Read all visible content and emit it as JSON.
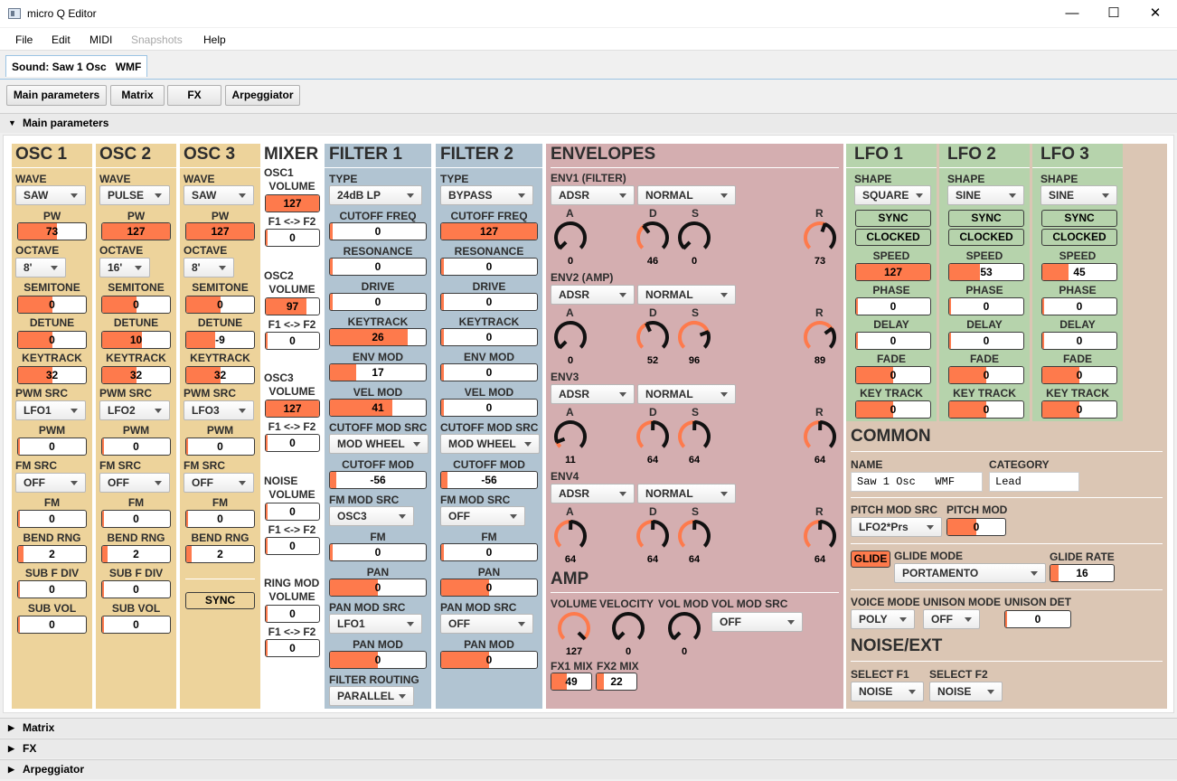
{
  "window": {
    "title": "micro Q Editor"
  },
  "menu": [
    "File",
    "Edit",
    "MIDI",
    "Snapshots",
    "Help"
  ],
  "tab": "Sound: Saw 1 Osc   WMF",
  "sections": [
    "Main parameters",
    "Matrix",
    "FX",
    "Arpeggiator"
  ],
  "lbl": {
    "wave": "WAVE",
    "pw": "PW",
    "octave": "OCTAVE",
    "semitone": "SEMITONE",
    "detune": "DETUNE",
    "keytrack": "KEYTRACK",
    "pwmsrc": "PWM SRC",
    "pwm": "PWM",
    "fmsrc": "FM SRC",
    "fm": "FM",
    "bendrng": "BEND RNG",
    "subfdiv": "SUB F DIV",
    "subvol": "SUB VOL",
    "sync": "SYNC",
    "volume": "VOLUME",
    "f1f2": "F1 <-> F2",
    "type": "TYPE",
    "cutoff": "CUTOFF FREQ",
    "reso": "RESONANCE",
    "drive": "DRIVE",
    "envmod": "ENV MOD",
    "velmod": "VEL MOD",
    "cutmodsrc": "CUTOFF MOD SRC",
    "cutmod": "CUTOFF MOD",
    "fmmodsrc": "FM MOD SRC",
    "pan": "PAN",
    "panmodsrc": "PAN MOD SRC",
    "panmod": "PAN MOD",
    "routing": "FILTER ROUTING",
    "shape": "SHAPE",
    "clocked": "CLOCKED",
    "speed": "SPEED",
    "phase": "PHASE",
    "delay": "DELAY",
    "fade": "FADE",
    "keytrack2": "KEY TRACK",
    "A": "A",
    "D": "D",
    "S": "S",
    "R": "R"
  },
  "osc": [
    {
      "title": "OSC 1",
      "wave": "SAW",
      "pw": "73",
      "octave": "8'",
      "semitone": "0",
      "detune": "0",
      "keytrack": "32",
      "pwmsrc": "LFO1",
      "pwm": "0",
      "fmsrc": "OFF",
      "fm": "0",
      "bend": "2",
      "subfdiv": "0",
      "subvol": "0"
    },
    {
      "title": "OSC 2",
      "wave": "PULSE",
      "pw": "127",
      "octave": "16'",
      "semitone": "0",
      "detune": "10",
      "keytrack": "32",
      "pwmsrc": "LFO2",
      "pwm": "0",
      "fmsrc": "OFF",
      "fm": "0",
      "bend": "2",
      "subfdiv": "0",
      "subvol": "0"
    },
    {
      "title": "OSC 3",
      "wave": "SAW",
      "pw": "127",
      "octave": "8'",
      "semitone": "0",
      "detune": "-9",
      "keytrack": "32",
      "pwmsrc": "LFO3",
      "pwm": "0",
      "fmsrc": "OFF",
      "fm": "0",
      "bend": "2"
    }
  ],
  "mixer": {
    "title": "MIXER",
    "rows": [
      {
        "name1": "OSC1",
        "name2": "VOLUME",
        "vol": "127",
        "f": "0"
      },
      {
        "name1": "OSC2",
        "name2": "VOLUME",
        "vol": "97",
        "f": "0"
      },
      {
        "name1": "OSC3",
        "name2": "VOLUME",
        "vol": "127",
        "f": "0"
      },
      {
        "name1": "NOISE",
        "name2": "VOLUME",
        "vol": "0",
        "f": "0"
      },
      {
        "name1": "RING MOD",
        "name2": "VOLUME",
        "vol": "0",
        "f": "0"
      }
    ]
  },
  "filter": [
    {
      "title": "FILTER 1",
      "type": "24dB LP",
      "cutoff": "0",
      "reso": "0",
      "drive": "0",
      "keytrack": "26",
      "envmod": "17",
      "velmod": "41",
      "cutmodsrc": "MOD WHEEL",
      "cutmod": "-56",
      "fmmodsrc": "OSC3",
      "fm": "0",
      "pan": "0",
      "panmodsrc": "LFO1",
      "panmod": "0",
      "routing": "PARALLEL"
    },
    {
      "title": "FILTER 2",
      "type": "BYPASS",
      "cutoff": "127",
      "reso": "0",
      "drive": "0",
      "keytrack": "0",
      "envmod": "0",
      "velmod": "0",
      "cutmodsrc": "MOD WHEEL",
      "cutmod": "-56",
      "fmmodsrc": "OFF",
      "fm": "0",
      "pan": "0",
      "panmodsrc": "OFF",
      "panmod": "0"
    }
  ],
  "env": {
    "title": "ENVELOPES",
    "items": [
      {
        "name": "ENV1 (FILTER)",
        "mode": "ADSR",
        "trig": "NORMAL",
        "a": "0",
        "d": "46",
        "s": "0",
        "r": "73"
      },
      {
        "name": "ENV2 (AMP)",
        "mode": "ADSR",
        "trig": "NORMAL",
        "a": "0",
        "d": "52",
        "s": "96",
        "r": "89"
      },
      {
        "name": "ENV3",
        "mode": "ADSR",
        "trig": "NORMAL",
        "a": "11",
        "d": "64",
        "s": "64",
        "r": "64"
      },
      {
        "name": "ENV4",
        "mode": "ADSR",
        "trig": "NORMAL",
        "a": "64",
        "d": "64",
        "s": "64",
        "r": "64"
      }
    ]
  },
  "amp": {
    "title": "AMP",
    "volume_lbl": "VOLUME",
    "velocity_lbl": "VELOCITY",
    "volmod_lbl": "VOL MOD",
    "volmodsrc_lbl": "VOL MOD SRC",
    "volume": "127",
    "velocity": "0",
    "volmod": "0",
    "volmodsrc": "OFF",
    "fx1_lbl": "FX1 MIX",
    "fx2_lbl": "FX2 MIX",
    "fx1": "49",
    "fx2": "22"
  },
  "lfo": [
    {
      "title": "LFO 1",
      "shape": "SQUARE",
      "speed": "127",
      "phase": "0",
      "delay": "0",
      "fade": "0",
      "keytrack": "0"
    },
    {
      "title": "LFO 2",
      "shape": "SINE",
      "speed": "53",
      "phase": "0",
      "delay": "0",
      "fade": "0",
      "keytrack": "0"
    },
    {
      "title": "LFO 3",
      "shape": "SINE",
      "speed": "45",
      "phase": "0",
      "delay": "0",
      "fade": "0",
      "keytrack": "0"
    }
  ],
  "common": {
    "title": "COMMON",
    "name_lbl": "NAME",
    "name": "Saw 1 Osc   WMF",
    "cat_lbl": "CATEGORY",
    "cat": "Lead",
    "pmsrc_lbl": "PITCH MOD SRC",
    "pmsrc": "LFO2*Prs",
    "pm_lbl": "PITCH MOD",
    "pm": "0",
    "glide": "GLIDE",
    "gmode_lbl": "GLIDE MODE",
    "gmode": "PORTAMENTO",
    "grate_lbl": "GLIDE RATE",
    "grate": "16",
    "vmode_lbl": "VOICE MODE",
    "vmode": "POLY",
    "umode_lbl": "UNISON MODE",
    "umode": "OFF",
    "udet_lbl": "UNISON DET",
    "udet": "0"
  },
  "noise": {
    "title": "NOISE/EXT",
    "f1_lbl": "SELECT F1",
    "f2_lbl": "SELECT F2",
    "f1": "NOISE",
    "f2": "NOISE"
  }
}
